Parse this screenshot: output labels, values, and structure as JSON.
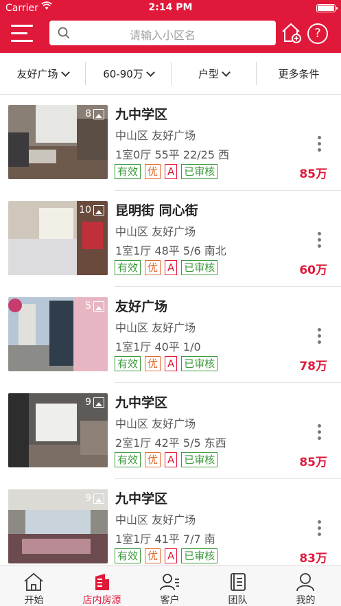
{
  "status": {
    "carrier": "Carrier",
    "time": "2:14 PM"
  },
  "search": {
    "placeholder": "请输入小区名"
  },
  "filters": [
    {
      "label": "友好广场"
    },
    {
      "label": "60-90万"
    },
    {
      "label": "户型"
    },
    {
      "label": "更多条件"
    }
  ],
  "listings": [
    {
      "title": "九中学区",
      "location": "中山区 友好广场",
      "spec": "1室0厅 55平 22/25 西",
      "photos": "8",
      "tags": [
        "有效",
        "优",
        "A",
        "已审核"
      ],
      "price": "85万"
    },
    {
      "title": "昆明街 同心街",
      "location": "中山区 友好广场",
      "spec": "1室1厅 48平 5/6 南北",
      "photos": "10",
      "tags": [
        "有效",
        "优",
        "A",
        "已审核"
      ],
      "price": "60万"
    },
    {
      "title": "友好广场",
      "location": "中山区 友好广场",
      "spec": "1室1厅 40平 1/0",
      "photos": "5",
      "tags": [
        "有效",
        "优",
        "A",
        "已审核"
      ],
      "price": "78万"
    },
    {
      "title": "九中学区",
      "location": "中山区 友好广场",
      "spec": "2室1厅 42平 5/5 东西",
      "photos": "9",
      "tags": [
        "有效",
        "优",
        "A",
        "已审核"
      ],
      "price": "85万"
    },
    {
      "title": "九中学区",
      "location": "中山区 友好广场",
      "spec": "1室1厅 41平 7/7 南",
      "photos": "9",
      "tags": [
        "有效",
        "优",
        "A",
        "已审核"
      ],
      "price": "83万"
    }
  ],
  "tabs": [
    {
      "label": "开始",
      "icon": "home-icon"
    },
    {
      "label": "店内房源",
      "icon": "building-icon"
    },
    {
      "label": "客户",
      "icon": "user-list-icon"
    },
    {
      "label": "团队",
      "icon": "book-icon"
    },
    {
      "label": "我的",
      "icon": "person-icon"
    }
  ],
  "colors": {
    "brand": "#e0193a",
    "tag_green": "#3c9a3c",
    "tag_orange": "#e26a2c"
  }
}
